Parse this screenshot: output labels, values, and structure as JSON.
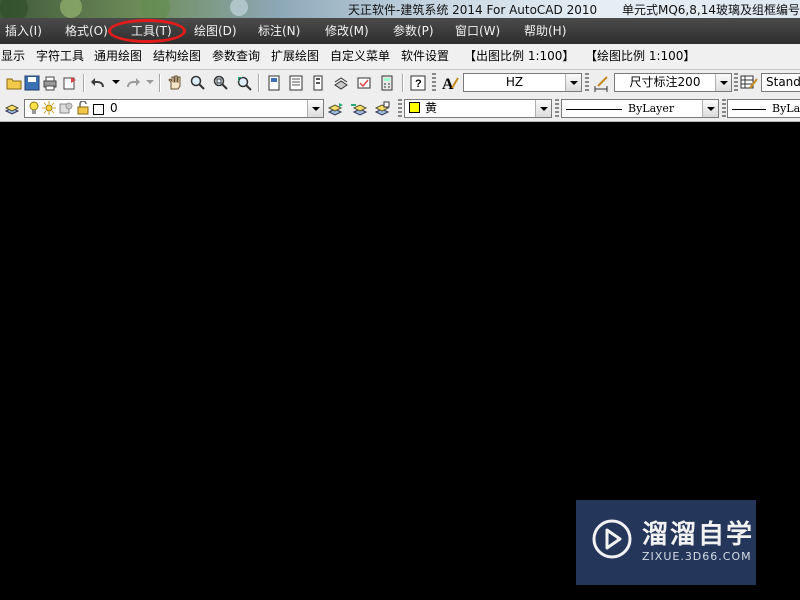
{
  "window": {
    "title": "天正软件-建筑系统 2014  For AutoCAD 2010",
    "document": "单元式MQ6,8,14玻璃及组框编号"
  },
  "menubar": {
    "items": [
      "插入(I)",
      "格式(O)",
      "工具(T)",
      "绘图(D)",
      "标注(N)",
      "修改(M)",
      "参数(P)",
      "窗口(W)",
      "帮助(H)"
    ],
    "highlighted": "工具(T)",
    "highlight_color": "#e21b1b"
  },
  "tz_toolbar": {
    "items": [
      "显示",
      "字符工具",
      "通用绘图",
      "结构绘图",
      "参数查询",
      "扩展绘图",
      "自定义菜单",
      "软件设置",
      "【出图比例 1:100】",
      "【绘图比例 1:100】"
    ]
  },
  "std_toolbar": {
    "icons": [
      "open-icon",
      "save-icon",
      "print-icon",
      "publish-icon",
      "undo-icon",
      "redo-icon",
      "pan-icon",
      "zoom-realtime-icon",
      "zoom-window-icon",
      "zoom-previous-icon",
      "properties-icon",
      "design-center-icon",
      "tool-palettes-icon",
      "sheet-set-icon",
      "markup-icon",
      "calculator-icon",
      "help-icon",
      "text-style-icon",
      "dim-style-icon",
      "table-style-icon"
    ],
    "text_style": "HZ",
    "dim_style": "尺寸标注200",
    "table_style": "Standa"
  },
  "layer_toolbar": {
    "icons": [
      "layer-properties-icon",
      "layer-on-bulb-icon",
      "layer-thaw-sun-icon",
      "layer-viewport-icon",
      "layer-lock-icon",
      "layer-color-swatch-icon",
      "make-current-icon",
      "layer-previous-icon",
      "layer-state-icon"
    ],
    "current_layer": "0",
    "color": "黄",
    "color_swatch": "#ffff00",
    "linetype": "ByLayer",
    "lineweight": "ByLay"
  },
  "watermark": {
    "name": "溜溜自学",
    "url": "ZIXUE.3D66.COM",
    "bg": "#26395e"
  }
}
